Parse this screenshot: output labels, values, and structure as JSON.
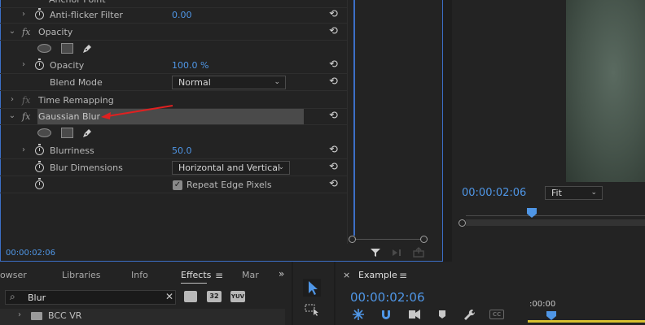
{
  "effect_controls": {
    "rows": {
      "anchor_point": {
        "label": "Anchor Point",
        "value": ""
      },
      "anti_flicker": {
        "label": "Anti-flicker Filter",
        "value": "0.00"
      },
      "opacity_group": {
        "label": "Opacity"
      },
      "opacity": {
        "label": "Opacity",
        "value": "100.0 %"
      },
      "blend_mode": {
        "label": "Blend Mode",
        "value": "Normal"
      },
      "time_remapping": {
        "label": "Time Remapping"
      },
      "gaussian_blur": {
        "label": "Gaussian Blur"
      },
      "blurriness": {
        "label": "Blurriness",
        "value": "50.0"
      },
      "blur_dimensions": {
        "label": "Blur Dimensions",
        "value": "Horizontal and Vertical"
      },
      "repeat_edge": {
        "label": "Repeat Edge Pixels",
        "checked": true
      }
    },
    "timecode": "00:00:02:06"
  },
  "program_monitor": {
    "timecode": "00:00:02:06",
    "zoom": "Fit"
  },
  "effects_panel": {
    "tabs": [
      "owser",
      "Libraries",
      "Info",
      "Effects",
      "Mar"
    ],
    "active_tab": "Effects",
    "search_value": "Blur",
    "badges": [
      "32",
      "YUV"
    ],
    "tree_item": "BCC VR"
  },
  "sequence": {
    "name": "Example",
    "timecode": "00:00:02:06",
    "ruler_label": ":00:00"
  },
  "colors": {
    "accent_blue": "#4f96e6",
    "panel_border": "#3c6fc7",
    "annotation_red": "#e02020"
  }
}
